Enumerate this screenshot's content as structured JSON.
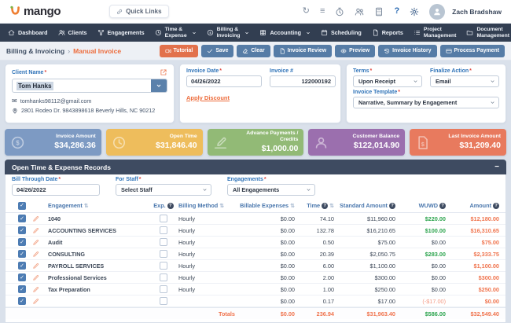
{
  "header": {
    "logo_text": "mango",
    "quick_links": "Quick Links",
    "user_name": "Zach Bradshaw"
  },
  "icons": {
    "sync": "↻",
    "menu": "≡",
    "help": "?",
    "envelope": "✉",
    "check": "✓",
    "sort": "⇅",
    "info": "?",
    "collapse": "−",
    "required": "*"
  },
  "nav": {
    "items": [
      {
        "label": "Dashboard",
        "icon": "home",
        "chevron": false,
        "two_line": false
      },
      {
        "label": "Clients",
        "icon": "users",
        "chevron": false,
        "two_line": false
      },
      {
        "label": "Engagements",
        "icon": "nodes",
        "chevron": false,
        "two_line": false
      },
      {
        "label": "Time & Expense",
        "icon": "clock",
        "chevron": true,
        "two_line": true
      },
      {
        "label": "Billing & Invoicing",
        "icon": "dollar",
        "chevron": true,
        "two_line": true
      },
      {
        "label": "Accounting",
        "icon": "grid",
        "chevron": true,
        "two_line": false
      },
      {
        "label": "Scheduling",
        "icon": "calendar",
        "chevron": false,
        "two_line": false
      },
      {
        "label": "Reports",
        "icon": "file",
        "chevron": false,
        "two_line": false
      },
      {
        "label": "Project Management",
        "icon": "list",
        "chevron": false,
        "two_line": true
      },
      {
        "label": "Document Management",
        "icon": "folder",
        "chevron": false,
        "two_line": true
      }
    ]
  },
  "breadcrumb": {
    "section": "Billing & Invoicing",
    "separator": "›",
    "page": "Manual Invoice"
  },
  "toolbar": {
    "tutorial": "Tutorial",
    "save": "Save",
    "clear": "Clear",
    "invoice_review": "Invoice Review",
    "preview": "Preview",
    "invoice_history": "Invoice History",
    "process_payment": "Process Payment"
  },
  "client": {
    "label": "Client Name",
    "value": "Tom Hanks",
    "email": "tomhanks98112@gmail.com",
    "address": "2801 Rodeo Dr. 9843898618 Beverly Hills, NC 90212"
  },
  "invoice": {
    "date_label": "Invoice Date",
    "date": "04/26/2022",
    "number_label": "Invoice #",
    "number": "122000192",
    "apply_discount": "Apply Discount"
  },
  "settings": {
    "terms_label": "Terms",
    "terms": "Upon Receipt",
    "finalize_label": "Finalize Action",
    "finalize": "Email",
    "template_label": "Invoice Template",
    "template": "Narrative, Summary by Engagement"
  },
  "summary": [
    {
      "label": "Invoice Amount",
      "value": "$34,286.36",
      "color": "#7d9ac3",
      "icon": "dollar"
    },
    {
      "label": "Open Time",
      "value": "$31,846.40",
      "color": "#eebd5c",
      "icon": "clock"
    },
    {
      "label": "Advance Payments / Credits",
      "value": "$1,000.00",
      "color": "#92ba76",
      "icon": "sign"
    },
    {
      "label": "Customer Balance",
      "value": "$122,014.90",
      "color": "#9b6fae",
      "icon": "person-o"
    },
    {
      "label": "Last Invoice Amount",
      "value": "$31,209.40",
      "color": "#e87a5e",
      "icon": "docdollar"
    }
  ],
  "panel": {
    "title": "Open Time & Expense Records",
    "filters": {
      "bill_through_label": "Bill Through Date",
      "bill_through": "04/26/2022",
      "staff_label": "For Staff",
      "staff": "Select Staff",
      "engagements_label": "Engagements",
      "engagements": "All Engagements"
    }
  },
  "table": {
    "columns": [
      {
        "label": "Engagement",
        "sort": true,
        "info": false
      },
      {
        "label": "Exp.",
        "sort": false,
        "info": true
      },
      {
        "label": "Billing Method",
        "sort": true,
        "info": false
      },
      {
        "label": "Billable Expenses",
        "sort": true,
        "info": false
      },
      {
        "label": "Time",
        "sort": true,
        "info": true
      },
      {
        "label": "Standard Amount",
        "sort": false,
        "info": true
      },
      {
        "label": "WUWD",
        "sort": false,
        "info": true
      },
      {
        "label": "Amount",
        "sort": false,
        "info": true
      }
    ],
    "rows": [
      {
        "engagement": "1040",
        "billing_method": "Hourly",
        "billable_expenses": "$0.00",
        "time": "74.10",
        "standard_amount": "$11,960.00",
        "wuwd": "$220.00",
        "wuwd_tone": "green",
        "amount": "$12,180.00"
      },
      {
        "engagement": "ACCOUNTING SERVICES",
        "billing_method": "Hourly",
        "billable_expenses": "$0.00",
        "time": "132.78",
        "standard_amount": "$16,210.65",
        "wuwd": "$100.00",
        "wuwd_tone": "green",
        "amount": "$16,310.65"
      },
      {
        "engagement": "Audit",
        "billing_method": "Hourly",
        "billable_expenses": "$0.00",
        "time": "0.50",
        "standard_amount": "$75.00",
        "wuwd": "$0.00",
        "wuwd_tone": "dark",
        "amount": "$75.00"
      },
      {
        "engagement": "CONSULTING",
        "billing_method": "Hourly",
        "billable_expenses": "$0.00",
        "time": "20.39",
        "standard_amount": "$2,050.75",
        "wuwd": "$283.00",
        "wuwd_tone": "green",
        "amount": "$2,333.75"
      },
      {
        "engagement": "PAYROLL SERVICES",
        "billing_method": "Hourly",
        "billable_expenses": "$0.00",
        "time": "6.00",
        "standard_amount": "$1,100.00",
        "wuwd": "$0.00",
        "wuwd_tone": "dark",
        "amount": "$1,100.00"
      },
      {
        "engagement": "Professional Services",
        "billing_method": "Hourly",
        "billable_expenses": "$0.00",
        "time": "2.00",
        "standard_amount": "$300.00",
        "wuwd": "$0.00",
        "wuwd_tone": "dark",
        "amount": "$300.00"
      },
      {
        "engagement": "Tax Preparation",
        "billing_method": "Hourly",
        "billable_expenses": "$0.00",
        "time": "1.00",
        "standard_amount": "$250.00",
        "wuwd": "$0.00",
        "wuwd_tone": "dark",
        "amount": "$250.00"
      },
      {
        "engagement": "",
        "billing_method": "",
        "billable_expenses": "$0.00",
        "time": "0.17",
        "standard_amount": "$17.00",
        "wuwd": "(-$17.00)",
        "wuwd_tone": "red",
        "amount": "$0.00"
      }
    ],
    "totals": {
      "label": "Totals",
      "billable_expenses": "$0.00",
      "time": "236.94",
      "standard_amount": "$31,963.40",
      "wuwd": "$586.00",
      "amount": "$32,549.40"
    }
  }
}
